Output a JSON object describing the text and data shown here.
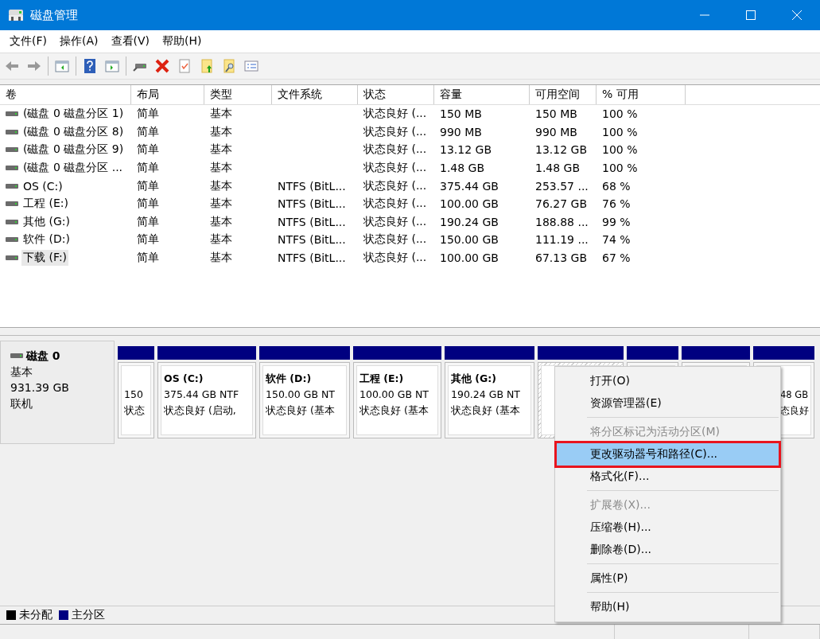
{
  "window": {
    "title": "磁盘管理"
  },
  "menu_bar": [
    "文件(F)",
    "操作(A)",
    "查看(V)",
    "帮助(H)"
  ],
  "table": {
    "columns": [
      "卷",
      "布局",
      "类型",
      "文件系统",
      "状态",
      "容量",
      "可用空间",
      "% 可用"
    ],
    "rows": [
      {
        "cells": [
          "(磁盘 0 磁盘分区 1)",
          "简单",
          "基本",
          "",
          "状态良好 (...",
          "150 MB",
          "150 MB",
          "100 %"
        ],
        "selected": false
      },
      {
        "cells": [
          "(磁盘 0 磁盘分区 8)",
          "简单",
          "基本",
          "",
          "状态良好 (...",
          "990 MB",
          "990 MB",
          "100 %"
        ],
        "selected": false
      },
      {
        "cells": [
          "(磁盘 0 磁盘分区 9)",
          "简单",
          "基本",
          "",
          "状态良好 (...",
          "13.12 GB",
          "13.12 GB",
          "100 %"
        ],
        "selected": false
      },
      {
        "cells": [
          "(磁盘 0 磁盘分区 ...",
          "简单",
          "基本",
          "",
          "状态良好 (...",
          "1.48 GB",
          "1.48 GB",
          "100 %"
        ],
        "selected": false
      },
      {
        "cells": [
          "OS (C:)",
          "简单",
          "基本",
          "NTFS (BitL...",
          "状态良好 (...",
          "375.44 GB",
          "253.57 ...",
          "68 %"
        ],
        "selected": false
      },
      {
        "cells": [
          "工程 (E:)",
          "简单",
          "基本",
          "NTFS (BitL...",
          "状态良好 (...",
          "100.00 GB",
          "76.27 GB",
          "76 %"
        ],
        "selected": false
      },
      {
        "cells": [
          "其他 (G:)",
          "简单",
          "基本",
          "NTFS (BitL...",
          "状态良好 (...",
          "190.24 GB",
          "188.88 ...",
          "99 %"
        ],
        "selected": false
      },
      {
        "cells": [
          "软件 (D:)",
          "简单",
          "基本",
          "NTFS (BitL...",
          "状态良好 (...",
          "150.00 GB",
          "111.19 ...",
          "74 %"
        ],
        "selected": false
      },
      {
        "cells": [
          "下载 (F:)",
          "简单",
          "基本",
          "NTFS (BitL...",
          "状态良好 (...",
          "100.00 GB",
          "67.13 GB",
          "67 %"
        ],
        "selected": true
      }
    ]
  },
  "disk": {
    "name": "磁盘 0",
    "type": "基本",
    "size": "931.39 GB",
    "status": "联机",
    "partitions": [
      {
        "size": "150",
        "status": "状态",
        "selected": false
      },
      {
        "name": "OS (C:)",
        "size": "375.44 GB NTF",
        "status": "状态良好 (启动,",
        "selected": false
      },
      {
        "name": "软件 (D:)",
        "size": "150.00 GB NT",
        "status": "状态良好 (基本",
        "selected": false
      },
      {
        "name": "工程 (E:)",
        "size": "100.00 GB NT",
        "status": "状态良好 (基本",
        "selected": false
      },
      {
        "name": "其他 (G:)",
        "size": "190.24 GB NT",
        "status": "状态良好 (基本",
        "selected": false
      },
      {
        "selected": true
      },
      {
        "selected": false
      },
      {
        "selected": false
      },
      {
        "size": "48 GB",
        "status": "态良好",
        "selected": false
      }
    ]
  },
  "legend": [
    {
      "label": "未分配",
      "color": "#000000"
    },
    {
      "label": "主分区",
      "color": "#000080"
    }
  ],
  "context_menu": [
    {
      "kind": "item",
      "label": "打开(O)",
      "disabled": false,
      "selected": false,
      "outlined": false
    },
    {
      "kind": "item",
      "label": "资源管理器(E)",
      "disabled": false,
      "selected": false,
      "outlined": false
    },
    {
      "kind": "separator"
    },
    {
      "kind": "item",
      "label": "将分区标记为活动分区(M)",
      "disabled": true,
      "selected": false,
      "outlined": false
    },
    {
      "kind": "item",
      "label": "更改驱动器号和路径(C)...",
      "disabled": false,
      "selected": true,
      "outlined": true
    },
    {
      "kind": "item",
      "label": "格式化(F)...",
      "disabled": false,
      "selected": false,
      "outlined": false
    },
    {
      "kind": "separator"
    },
    {
      "kind": "item",
      "label": "扩展卷(X)...",
      "disabled": true,
      "selected": false,
      "outlined": false
    },
    {
      "kind": "item",
      "label": "压缩卷(H)...",
      "disabled": false,
      "selected": false,
      "outlined": false
    },
    {
      "kind": "item",
      "label": "删除卷(D)...",
      "disabled": false,
      "selected": false,
      "outlined": false
    },
    {
      "kind": "separator"
    },
    {
      "kind": "item",
      "label": "属性(P)",
      "disabled": false,
      "selected": false,
      "outlined": false
    },
    {
      "kind": "separator"
    },
    {
      "kind": "item",
      "label": "帮助(H)",
      "disabled": false,
      "selected": false,
      "outlined": false
    }
  ]
}
